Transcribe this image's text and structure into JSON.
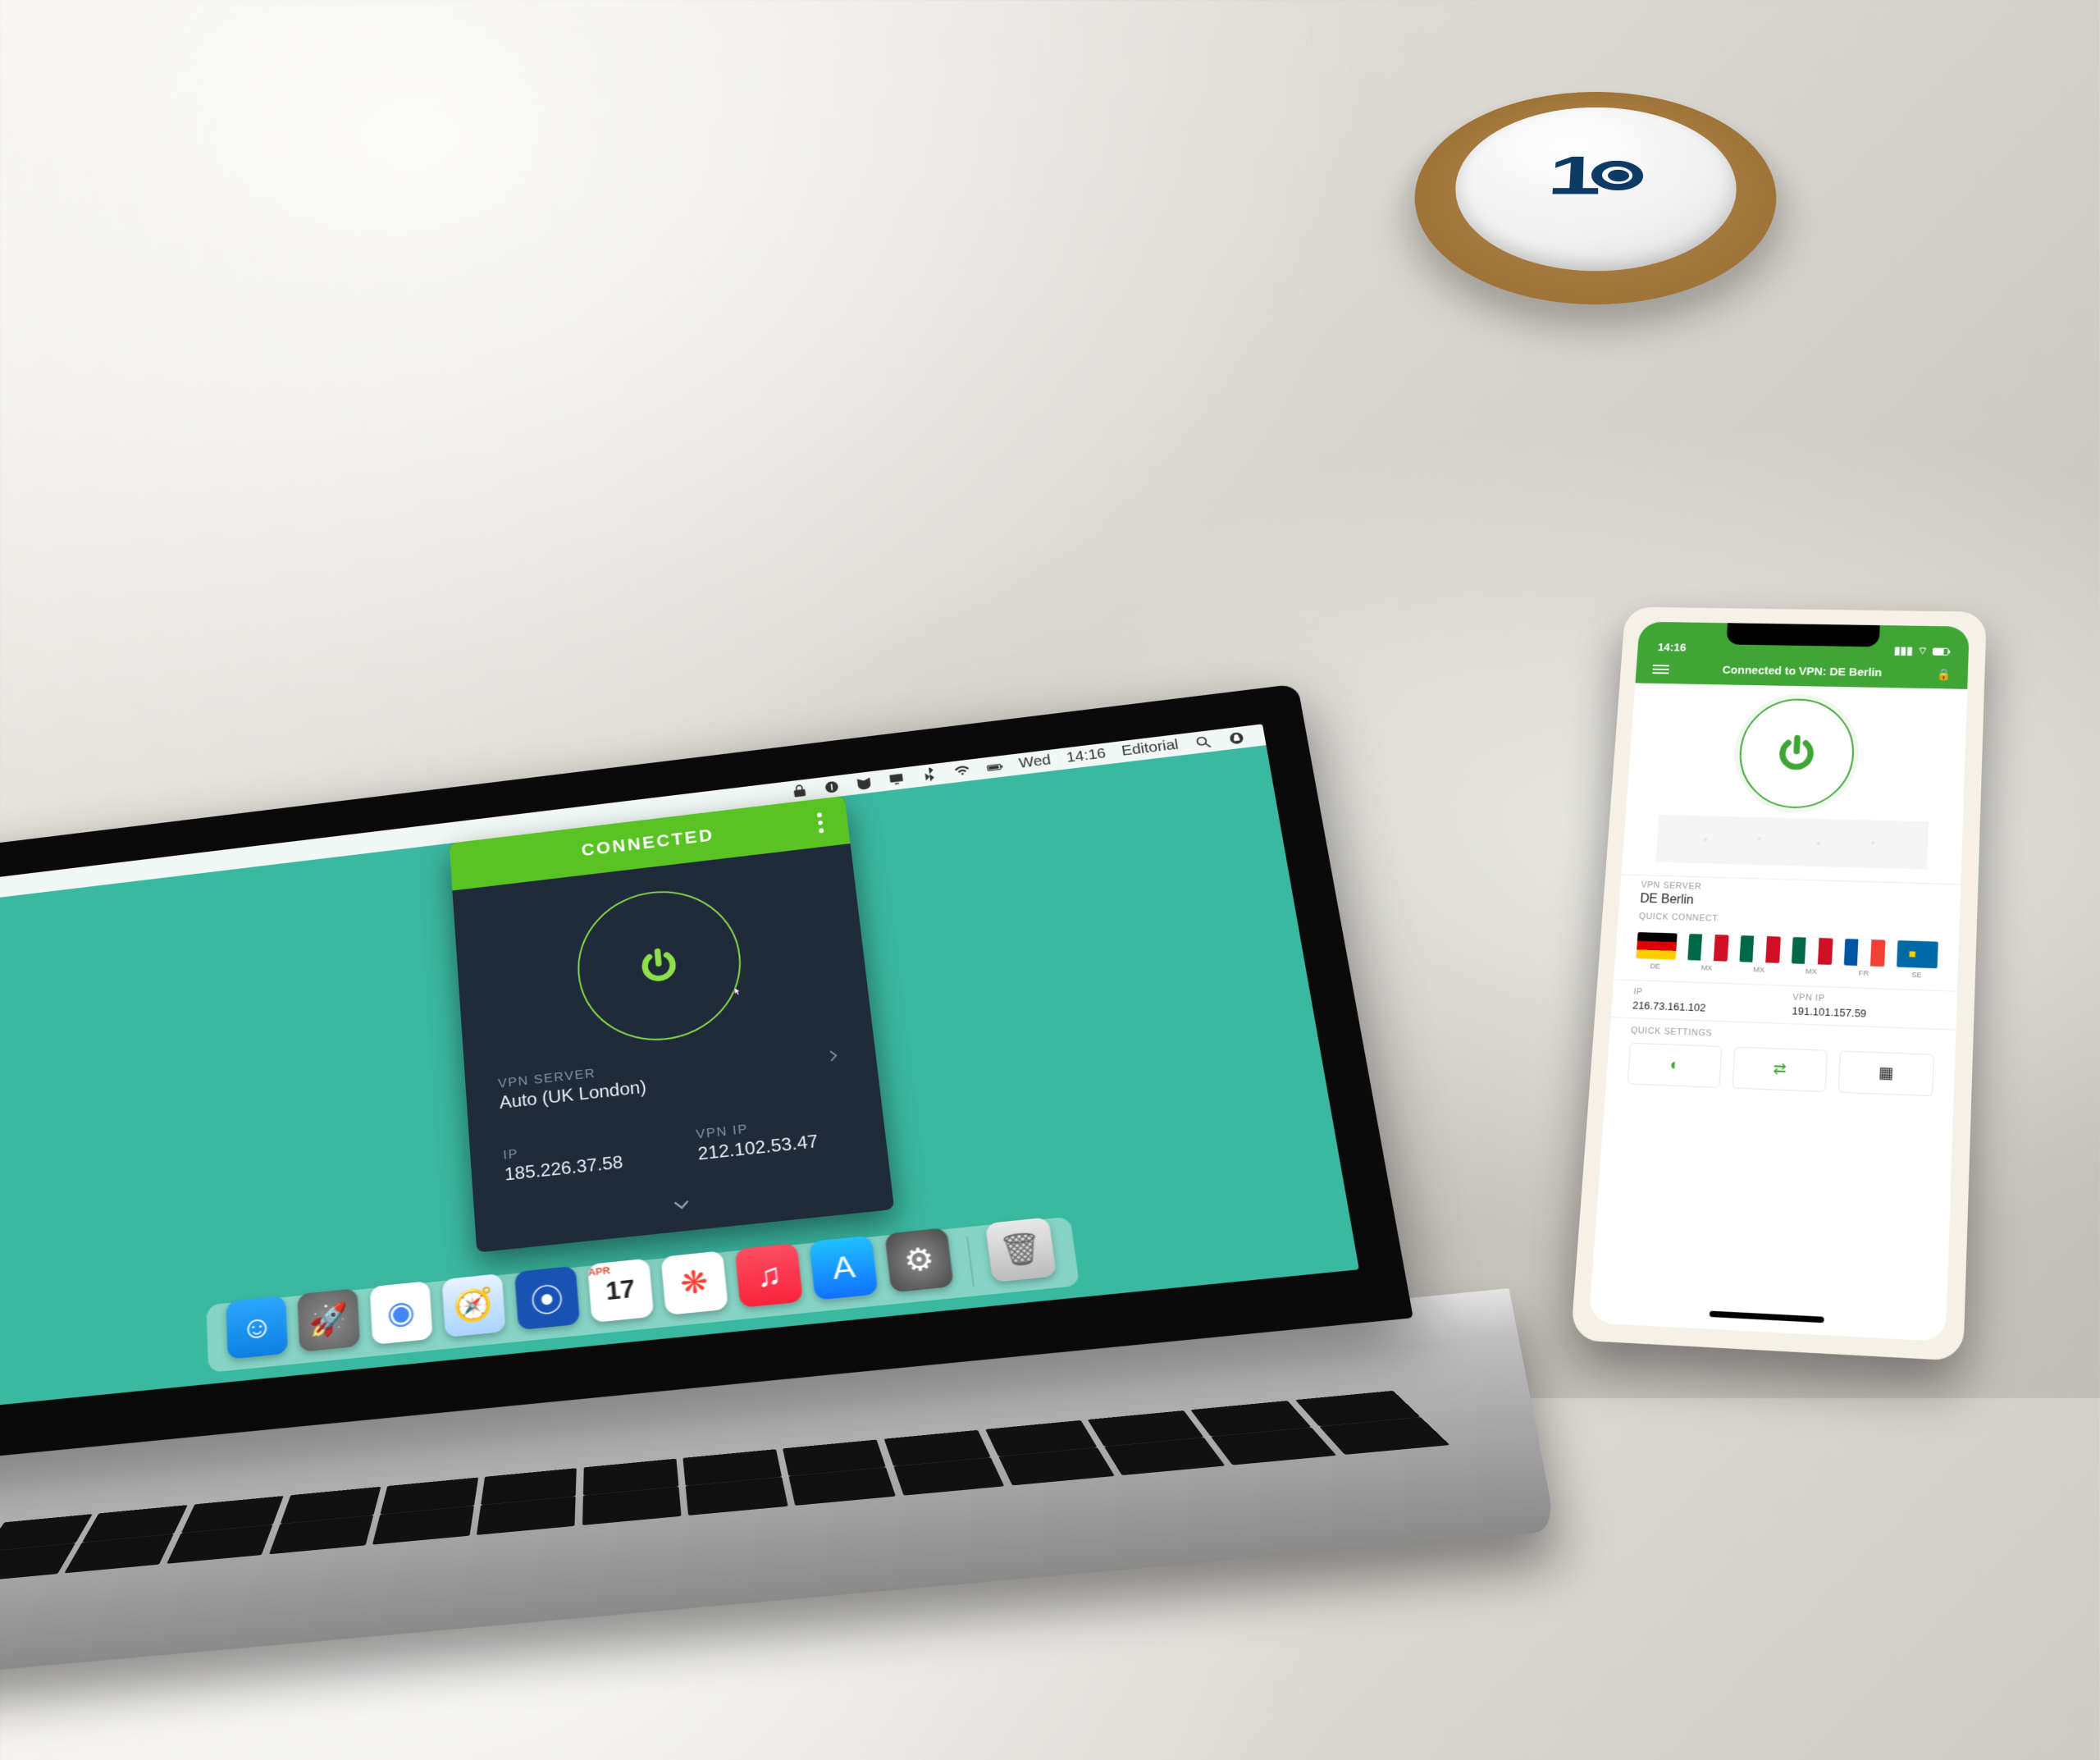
{
  "colors": {
    "accent_green": "#58c322",
    "dark_panel": "#1f2a3a",
    "mobile_green": "#3fa636",
    "desktop_bg": "#3bb8a0"
  },
  "mug": {
    "logo_text": "1"
  },
  "mac": {
    "menubar": {
      "day": "Wed",
      "time": "14:16",
      "user": "Editorial"
    },
    "dock": {
      "apps": [
        {
          "name": "finder",
          "bg": "linear-gradient(#2aa7ff,#0e7fe0)",
          "glyph": "☺"
        },
        {
          "name": "launchpad",
          "bg": "radial-gradient(circle,#8e8e8e,#5f5f5f)",
          "glyph": "🚀"
        },
        {
          "name": "chrome",
          "bg": "#fff",
          "glyph": "◉",
          "fg": "#4285f4"
        },
        {
          "name": "safari",
          "bg": "linear-gradient(#e8f3ff,#a9d4ff)",
          "glyph": "🧭"
        },
        {
          "name": "1password",
          "bg": "#1853b4",
          "glyph": "⦿"
        },
        {
          "name": "calendar",
          "bg": "#fff",
          "glyph": "17",
          "fg": "#222",
          "top": "APR"
        },
        {
          "name": "photos",
          "bg": "#fff",
          "glyph": "❋",
          "fg": "#ff3b30"
        },
        {
          "name": "apple-music",
          "bg": "linear-gradient(#fb4e62,#fa233b)",
          "glyph": "♫"
        },
        {
          "name": "app-store",
          "bg": "linear-gradient(#1fc1ff,#1171ff)",
          "glyph": "A"
        },
        {
          "name": "settings",
          "bg": "radial-gradient(circle,#8a8a8a,#4a4a4a)",
          "glyph": "⚙"
        }
      ],
      "trash_name": "trash"
    },
    "vpn": {
      "status": "CONNECTED",
      "server_label": "VPN SERVER",
      "server_value": "Auto (UK London)",
      "ip_label": "IP",
      "ip_value": "185.226.37.58",
      "vpn_ip_label": "VPN IP",
      "vpn_ip_value": "212.102.53.47"
    }
  },
  "phone": {
    "status": {
      "time": "14:16"
    },
    "appbar_title": "Connected to VPN: DE Berlin",
    "server_label": "VPN SERVER",
    "server_value": "DE Berlin",
    "quick_connect_label": "QUICK CONNECT",
    "flags": [
      {
        "cc": "de",
        "name": "Germany"
      },
      {
        "cc": "mx",
        "name": "Mexico"
      },
      {
        "cc": "mx",
        "name": "Mexico"
      },
      {
        "cc": "mx",
        "name": "Mexico"
      },
      {
        "cc": "fr",
        "name": "France"
      },
      {
        "cc": "se",
        "name": "Sweden"
      }
    ],
    "ip_label": "IP",
    "ip_value": "216.73.161.102",
    "vpn_ip_label": "VPN IP",
    "vpn_ip_value": "191.101.157.59",
    "quick_settings_label": "QUICK SETTINGS"
  }
}
